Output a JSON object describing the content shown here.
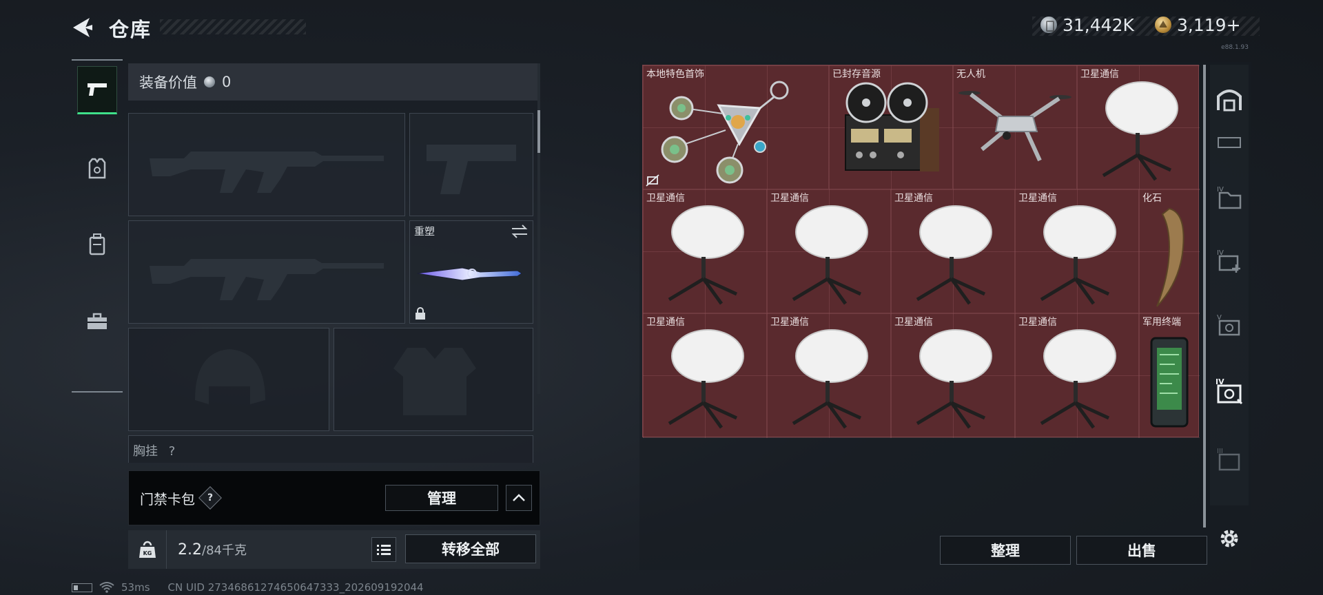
{
  "header": {
    "title": "仓库",
    "currency_silver": "31,442K",
    "currency_gold": "3,119+",
    "version_text": "e88.1.93"
  },
  "loadout": {
    "value_label": "装备价值",
    "value_amount": "0",
    "melee_label": "重塑",
    "chest_rig_label": "胸挂",
    "chest_rig_count": "?"
  },
  "cardbag": {
    "label": "门禁卡包",
    "help": "?",
    "manage_label": "管理"
  },
  "weight": {
    "current": "2.2",
    "max": "/84千克",
    "kg_icon_label": "KG"
  },
  "actions": {
    "transfer_all": "转移全部",
    "sort": "整理",
    "sell": "出售"
  },
  "status": {
    "ping": "53ms",
    "uid": "CN UID 27346861274650647333_202609192044"
  },
  "stash_items": [
    {
      "name": "本地特色首饰",
      "icon": "jewelry-pendant"
    },
    {
      "name": "已封存音源",
      "icon": "reel-to-reel-tape"
    },
    {
      "name": "无人机",
      "icon": "drone"
    },
    {
      "name": "卫星通信",
      "icon": "satellite-dish"
    },
    {
      "name": "卫星通信",
      "icon": "satellite-dish"
    },
    {
      "name": "卫星通信",
      "icon": "satellite-dish"
    },
    {
      "name": "卫星通信",
      "icon": "satellite-dish"
    },
    {
      "name": "卫星通信",
      "icon": "satellite-dish"
    },
    {
      "name": "化石",
      "icon": "fossil-claw"
    },
    {
      "name": "卫星通信",
      "icon": "satellite-dish"
    },
    {
      "name": "卫星通信",
      "icon": "satellite-dish"
    },
    {
      "name": "卫星通信",
      "icon": "satellite-dish"
    },
    {
      "name": "卫星通信",
      "icon": "satellite-dish"
    },
    {
      "name": "军用终端",
      "icon": "military-terminal"
    }
  ],
  "colors": {
    "accent_green": "#3fe08a",
    "stash_bg": "#5a2a2e"
  }
}
